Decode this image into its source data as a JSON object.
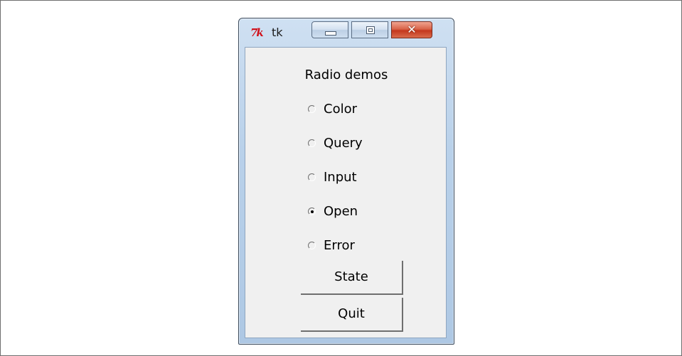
{
  "window": {
    "title": "tk",
    "icon": "tk-feather-icon",
    "icon_text": "7k"
  },
  "caption_buttons": {
    "minimize": "minimize-icon",
    "maximize": "maximize-icon",
    "close": "close-icon",
    "close_glyph": "✕"
  },
  "main": {
    "heading": "Radio demos",
    "radio_options": [
      {
        "label": "Color",
        "selected": false
      },
      {
        "label": "Query",
        "selected": false
      },
      {
        "label": "Input",
        "selected": false
      },
      {
        "label": "Open",
        "selected": true
      },
      {
        "label": "Error",
        "selected": false
      }
    ],
    "buttons": {
      "state": "State",
      "quit": "Quit"
    }
  },
  "colors": {
    "close_button": "#c4371d",
    "client_background": "#f0f0f0",
    "icon_red": "#d0101a"
  }
}
